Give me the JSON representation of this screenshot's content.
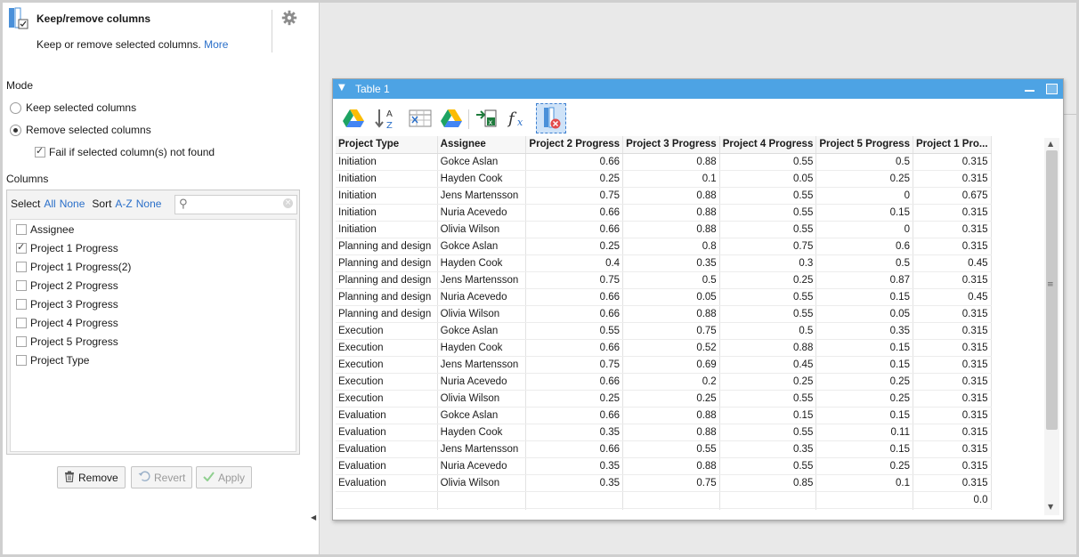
{
  "panel": {
    "title": "Keep/remove columns",
    "description": "Keep or remove selected columns.",
    "more_link": "More",
    "mode_label": "Mode",
    "mode_options": [
      {
        "label": "Keep selected columns",
        "selected": false
      },
      {
        "label": "Remove selected columns",
        "selected": true
      }
    ],
    "fail_label": "Fail if selected column(s) not found",
    "fail_checked": true,
    "columns_label": "Columns",
    "select_label": "Select",
    "select_all": "All",
    "select_none": "None",
    "sort_label": "Sort",
    "sort_az": "A-Z",
    "sort_none": "None",
    "search_placeholder": "",
    "column_items": [
      {
        "label": "Assignee",
        "checked": false
      },
      {
        "label": "Project 1 Progress",
        "checked": true
      },
      {
        "label": "Project 1 Progress(2)",
        "checked": false
      },
      {
        "label": "Project 2 Progress",
        "checked": false
      },
      {
        "label": "Project 3 Progress",
        "checked": false
      },
      {
        "label": "Project 4 Progress",
        "checked": false
      },
      {
        "label": "Project 5 Progress",
        "checked": false
      },
      {
        "label": "Project Type",
        "checked": false
      }
    ],
    "buttons": {
      "remove": "Remove",
      "revert": "Revert",
      "apply": "Apply"
    }
  },
  "table_window": {
    "title": "Table 1",
    "columns": [
      "Project Type",
      "Assignee",
      "Project 2 Progress",
      "Project 3 Progress",
      "Project 4 Progress",
      "Project 5 Progress",
      "Project 1 Pro..."
    ],
    "rows": [
      [
        "Initiation",
        "Gokce Aslan",
        "0.66",
        "0.88",
        "0.55",
        "0.5",
        "0.315"
      ],
      [
        "Initiation",
        "Hayden Cook",
        "0.25",
        "0.1",
        "0.05",
        "0.25",
        "0.315"
      ],
      [
        "Initiation",
        "Jens Martensson",
        "0.75",
        "0.88",
        "0.55",
        "0",
        "0.675"
      ],
      [
        "Initiation",
        "Nuria Acevedo",
        "0.66",
        "0.88",
        "0.55",
        "0.15",
        "0.315"
      ],
      [
        "Initiation",
        "Olivia Wilson",
        "0.66",
        "0.88",
        "0.55",
        "0",
        "0.315"
      ],
      [
        "Planning and design",
        "Gokce Aslan",
        "0.25",
        "0.8",
        "0.75",
        "0.6",
        "0.315"
      ],
      [
        "Planning and design",
        "Hayden Cook",
        "0.4",
        "0.35",
        "0.3",
        "0.5",
        "0.45"
      ],
      [
        "Planning and design",
        "Jens Martensson",
        "0.75",
        "0.5",
        "0.25",
        "0.87",
        "0.315"
      ],
      [
        "Planning and design",
        "Nuria Acevedo",
        "0.66",
        "0.05",
        "0.55",
        "0.15",
        "0.45"
      ],
      [
        "Planning and design",
        "Olivia Wilson",
        "0.66",
        "0.88",
        "0.55",
        "0.05",
        "0.315"
      ],
      [
        "Execution",
        "Gokce Aslan",
        "0.55",
        "0.75",
        "0.5",
        "0.35",
        "0.315"
      ],
      [
        "Execution",
        "Hayden Cook",
        "0.66",
        "0.52",
        "0.88",
        "0.15",
        "0.315"
      ],
      [
        "Execution",
        "Jens Martensson",
        "0.75",
        "0.69",
        "0.45",
        "0.15",
        "0.315"
      ],
      [
        "Execution",
        "Nuria Acevedo",
        "0.66",
        "0.2",
        "0.25",
        "0.25",
        "0.315"
      ],
      [
        "Execution",
        "Olivia Wilson",
        "0.25",
        "0.25",
        "0.55",
        "0.25",
        "0.315"
      ],
      [
        "Evaluation",
        "Gokce Aslan",
        "0.66",
        "0.88",
        "0.15",
        "0.15",
        "0.315"
      ],
      [
        "Evaluation",
        "Hayden Cook",
        "0.35",
        "0.88",
        "0.55",
        "0.11",
        "0.315"
      ],
      [
        "Evaluation",
        "Jens Martensson",
        "0.66",
        "0.55",
        "0.35",
        "0.15",
        "0.315"
      ],
      [
        "Evaluation",
        "Nuria Acevedo",
        "0.35",
        "0.88",
        "0.55",
        "0.25",
        "0.315"
      ],
      [
        "Evaluation",
        "Olivia Wilson",
        "0.35",
        "0.75",
        "0.85",
        "0.1",
        "0.315"
      ],
      [
        "",
        "",
        "",
        "",
        "",
        "",
        "0.0"
      ],
      [
        "",
        "",
        "",
        "",
        "",
        "",
        "0.0"
      ]
    ]
  },
  "toolbar_icons": [
    "drive-icon",
    "sort-az-icon",
    "table-edit-icon",
    "drive-icon",
    "export-excel-icon",
    "formula-icon",
    "keep-remove-columns-icon"
  ]
}
